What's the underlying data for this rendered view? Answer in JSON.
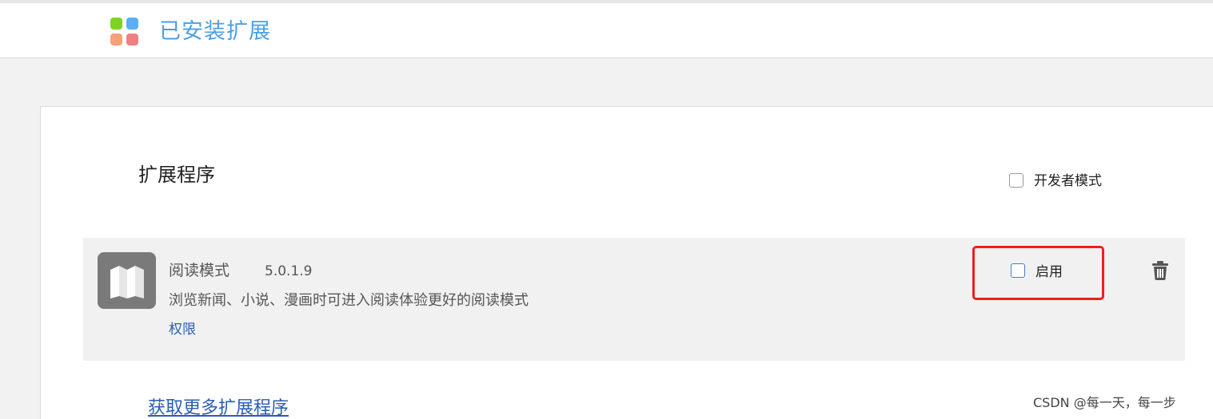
{
  "header": {
    "title": "已安装扩展",
    "logo_colors": [
      "#7ed321",
      "#5aaef5",
      "#f7a07a",
      "#f08080"
    ],
    "title_color": "#4a9fe6"
  },
  "main": {
    "section_title": "扩展程序",
    "developer_mode": {
      "label": "开发者模式",
      "checked": false
    },
    "extensions": [
      {
        "name": "阅读模式",
        "version": "5.0.1.9",
        "description": "浏览新闻、小说、漫画时可进入阅读体验更好的阅读模式",
        "permissions_link": "权限",
        "enable_label": "启用",
        "enabled": false,
        "icon": "book-icon",
        "remove_icon": "trash-icon"
      }
    ],
    "more_link": "获取更多扩展程序"
  },
  "watermark": "CSDN @每一天，每一步",
  "colors": {
    "highlight_border": "#e8221b",
    "link": "#2a5db0"
  }
}
